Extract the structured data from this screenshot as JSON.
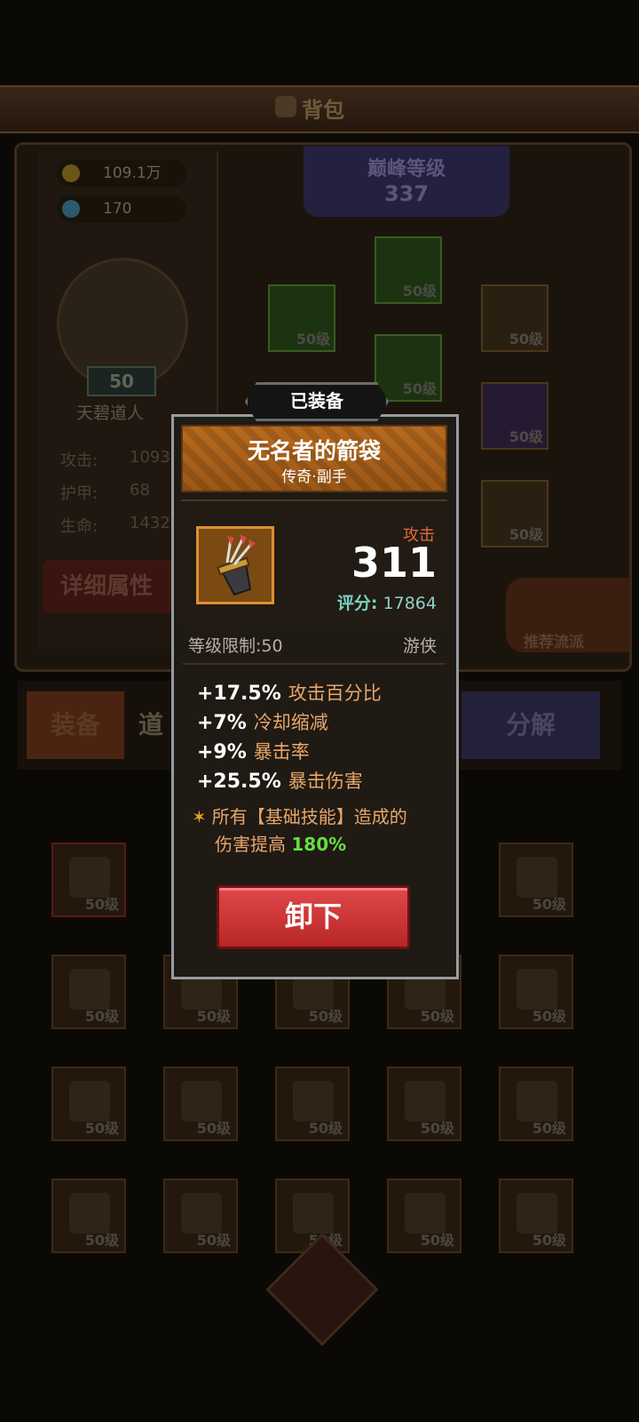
{
  "header": {
    "title": "背包"
  },
  "currency": {
    "gold": "109.1万",
    "gems": "170"
  },
  "character": {
    "level": "50",
    "name": "天碧道人"
  },
  "stats": [
    {
      "label": "攻击:",
      "value": "1093"
    },
    {
      "label": "护甲:",
      "value": "68"
    },
    {
      "label": "生命:",
      "value": "1432"
    }
  ],
  "detail_button": "详细属性",
  "peak": {
    "label": "巅峰等级",
    "value": "337"
  },
  "equip_level_label": "50级",
  "recommend_label": "推荐流派",
  "tabs": {
    "equip": "装备",
    "items": "道",
    "decompose": "分解"
  },
  "modal": {
    "equipped_tab": "已装备",
    "item_name": "无名者的箭袋",
    "item_type": "传奇·副手",
    "attack_label": "攻击",
    "attack_value": "311",
    "score_label": "评分:",
    "score_value": "17864",
    "level_req": "等级限制:50",
    "class": "游侠",
    "attrs": [
      {
        "value": "+17.5%",
        "name": "攻击百分比"
      },
      {
        "value": "+7%",
        "name": "冷却缩减"
      },
      {
        "value": "+9%",
        "name": "暴击率"
      },
      {
        "value": "+25.5%",
        "name": "暴击伤害"
      }
    ],
    "skill_text_1": "所有【基础技能】造成的",
    "skill_text_2": "伤害提高",
    "skill_pct": "180%",
    "unequip_button": "卸下"
  },
  "colors": {
    "accent_orange": "#b86a1e",
    "button_red": "#c83030",
    "green_pct": "#66dd44"
  }
}
